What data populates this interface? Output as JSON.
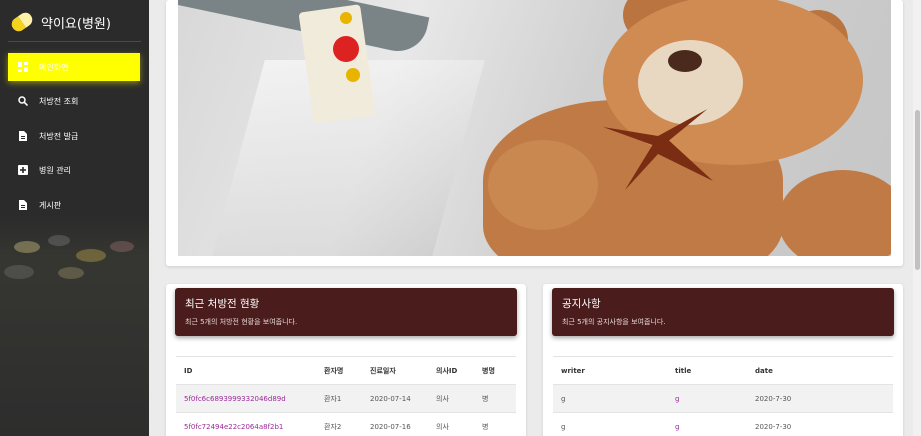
{
  "app": {
    "title": "약이요(병원)"
  },
  "sidebar": {
    "items": [
      {
        "label": "메인화면",
        "icon": "dashboard-icon",
        "active": true
      },
      {
        "label": "처방전 조회",
        "icon": "search-icon",
        "active": false
      },
      {
        "label": "처방전 발급",
        "icon": "document-icon",
        "active": false
      },
      {
        "label": "병원 관리",
        "icon": "plus-box-icon",
        "active": false
      },
      {
        "label": "게시판",
        "icon": "document-icon",
        "active": false
      }
    ]
  },
  "recent_prescriptions": {
    "title": "최근 처방전 현황",
    "subtitle": "최근 5개의 처방전 현황을 보여줍니다.",
    "columns": [
      "ID",
      "환자명",
      "진료일자",
      "의사ID",
      "병명"
    ],
    "rows": [
      [
        "5f0fc6c6893999332046d89d",
        "환자1",
        "2020-07-14",
        "의사",
        "병"
      ],
      [
        "5f0fc72494e22c2064a8f2b1",
        "환자2",
        "2020-07-16",
        "의사",
        "병"
      ]
    ]
  },
  "notices": {
    "title": "공지사항",
    "subtitle": "최근 5개의 공지사항을 보여줍니다.",
    "columns": [
      "writer",
      "title",
      "date"
    ],
    "rows": [
      [
        "g",
        "g",
        "2020-7-30"
      ],
      [
        "g",
        "g",
        "2020-7-30"
      ]
    ]
  },
  "colors": {
    "accent": "#ffff00",
    "header": "#4a1c1c",
    "link": "#9b2a9b",
    "sidebar": "#2b2b2b"
  }
}
